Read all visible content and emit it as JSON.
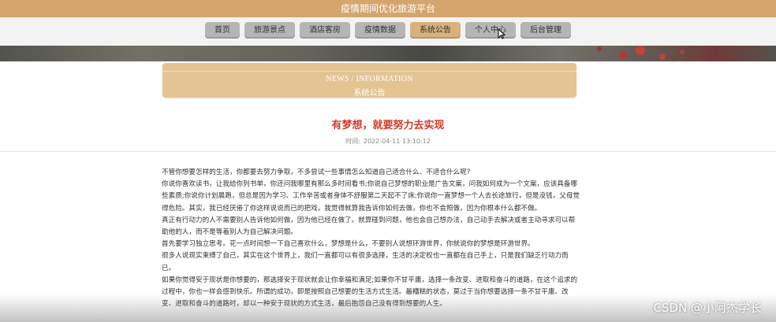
{
  "header": {
    "title": "疫情期间优化旅游平台"
  },
  "nav": {
    "items": [
      {
        "label": "首页"
      },
      {
        "label": "旅游景点"
      },
      {
        "label": "酒店客房"
      },
      {
        "label": "疫情数据"
      },
      {
        "label": "系统公告",
        "active": true
      },
      {
        "label": "个人中心"
      },
      {
        "label": "后台管理"
      }
    ]
  },
  "section": {
    "title_en": "NEWS / INFORMATION",
    "title_cn": "系统公告"
  },
  "article": {
    "title": "有梦想，就要努力去实现",
    "time_label": "时间:",
    "time_value": "2022-04-11 13:10:12",
    "lines": [
      "不管你想要怎样的生活，你都要去努力争取，不多尝试一些事情怎么知道自己适合什么、不适合什么呢?",
      "你说你喜欢读书，让我给你列书单，你还问我哪里有那么多时间看书;你说自己梦想的职业是广告文案，问我如何成为一个文案，应该具备哪些素质;你说你计划晨跑，但总是因为学习、工作辛苦或者身体不舒服第二天起不了床;你说你一直梦想一个人去长途旅行，但是没钱，父母觉得危险。其实，我已经厌倦了你这样说说而已的把戏，我觉得就算我告诉你如何去做，你也不会照做，因为你根本什么都不做。",
      "真正有行动力的人不需要别人告诉他如何做，因为他已经在做了。就算碰到问题，他也会自己想办法，自己动手去解决或者主动寻求可以帮助他的人，而不是等着别人为自己解决问题。",
      "首先要学习独立思考。花一点时间想一下自己喜欢什么，梦想是什么，不要别人说想环游世界，你就说你的梦想是环游世界。",
      "很多人说现实束缚了自己，其实在这个世界上，我们一直都可以有很多选择，生活的决定权也一直都在自己手上，只是我们缺乏行动力而已。",
      "如果你觉得安于现状是你想要的，那选择安于现状就会让你幸福和满足;如果你不甘平庸，选择一条改变、进取和奋斗的道路，在这个追求的过程中，你也一样会感到快乐。所谓的成功，即是按照自己想要的生活方式生活。最糟糕的状态，莫过于当你想要选择一条不甘平庸、改变、进取和奋斗的道路时，却以一种安于现状的方式生活，最后抱怨自己没有得到想要的人生。"
    ]
  },
  "watermark": "CSDN @小阿杰学长",
  "colors": {
    "header_bg": "#d4a56d",
    "nav_active": "#d8b17c",
    "nav_default": "#b5b5b5",
    "title_red": "#d33a2c",
    "section_box": "#e4c493"
  }
}
